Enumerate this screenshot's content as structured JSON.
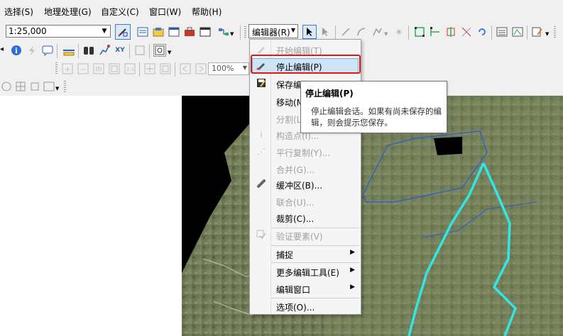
{
  "menubar": {
    "items": [
      "选择(S)",
      "地理处理(G)",
      "自定义(C)",
      "窗口(W)",
      "帮助(H)"
    ]
  },
  "toolbar": {
    "scale_value": "1:25,000",
    "editor_label": "编辑器(R)",
    "zoom_value": "100%"
  },
  "editor_menu": {
    "items": [
      {
        "label": "开始编辑(T)",
        "enabled": false,
        "icon": "start-editing-icon"
      },
      {
        "label": "停止编辑(P)",
        "enabled": true,
        "highlighted": true,
        "icon": "stop-editing-icon"
      },
      {
        "label": "保存编辑",
        "enabled": true,
        "icon": "save-edits-icon"
      },
      {
        "label": "移动(M)",
        "enabled": true
      },
      {
        "label": "分割(L)",
        "enabled": false
      },
      {
        "label": "构造点(I)...",
        "enabled": false,
        "icon": "construct-points-icon"
      },
      {
        "label": "平行复制(Y)...",
        "enabled": false,
        "icon": "copy-parallel-icon"
      },
      {
        "label": "合并(G)...",
        "enabled": false
      },
      {
        "label": "缓冲区(B)...",
        "enabled": true,
        "icon": "buffer-icon"
      },
      {
        "label": "联合(U)...",
        "enabled": false
      },
      {
        "label": "裁剪(C)...",
        "enabled": true
      },
      {
        "label": "验证要素(V)",
        "enabled": false,
        "icon": "validate-features-icon"
      },
      {
        "label": "捕捉",
        "enabled": true,
        "submenu": true
      },
      {
        "label": "更多编辑工具(E)",
        "enabled": true,
        "submenu": true
      },
      {
        "label": "编辑窗口",
        "enabled": true,
        "submenu": true
      },
      {
        "label": "选项(O)...",
        "enabled": true
      }
    ]
  },
  "tooltip": {
    "title": "停止编辑(P)",
    "body": "停止编辑会话。如果有尚未保存的编辑，则会提示您保存。"
  },
  "colors": {
    "highlight": "#cde4f7",
    "callout_border": "#e01818",
    "river": "#33e6e6",
    "boundary": "#2a5ad8"
  }
}
